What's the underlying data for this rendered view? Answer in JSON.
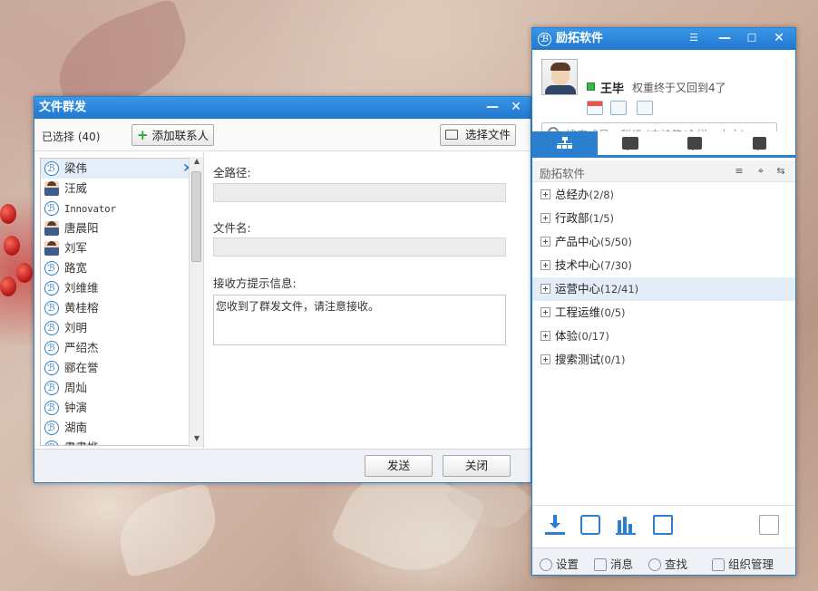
{
  "broadcast_window": {
    "title": "文件群发",
    "minimize": "—",
    "close": "✕",
    "selected_count": "已选择 (40)",
    "add_contact": "添加联系人",
    "select_file": "选择文件",
    "contacts": [
      {
        "name": "梁伟",
        "icon": "logo"
      },
      {
        "name": "汪威",
        "icon": "avatar"
      },
      {
        "name": "Innovator",
        "icon": "logo"
      },
      {
        "name": "唐晨阳",
        "icon": "avatar"
      },
      {
        "name": "刘军",
        "icon": "avatar"
      },
      {
        "name": "路宽",
        "icon": "logo"
      },
      {
        "name": "刘维维",
        "icon": "logo"
      },
      {
        "name": "黄桂榕",
        "icon": "logo"
      },
      {
        "name": "刘明",
        "icon": "logo"
      },
      {
        "name": "严绍杰",
        "icon": "logo"
      },
      {
        "name": "郦在誉",
        "icon": "logo"
      },
      {
        "name": "周灿",
        "icon": "logo"
      },
      {
        "name": "钟演",
        "icon": "logo"
      },
      {
        "name": "湖南",
        "icon": "logo"
      },
      {
        "name": "書書桦",
        "icon": "logo"
      }
    ],
    "full_path_label": "全路径:",
    "full_path_value": "",
    "file_name_label": "文件名:",
    "file_name_value": "",
    "receiver_hint_label": "接收方提示信息:",
    "receiver_hint_value": "您收到了群发文件，请注意接收。",
    "send_button": "发送",
    "close_button": "关闭"
  },
  "client_window": {
    "title": "励拓软件",
    "user": {
      "name": "王毕",
      "signature": "权重终于又回到4了",
      "status_color": "#39b54a"
    },
    "search_placeholder": "搜索成员、群组 (支持简/全拼、中文).",
    "tabs": [
      "organization",
      "chat",
      "message",
      "notice"
    ],
    "group_header": "励拓软件",
    "departments": [
      {
        "name": "总经办",
        "count": "(2/8)"
      },
      {
        "name": "行政部",
        "count": "(1/5)"
      },
      {
        "name": "产品中心",
        "count": "(5/50)"
      },
      {
        "name": "技术中心",
        "count": "(7/30)"
      },
      {
        "name": "运营中心",
        "count": "(12/41)"
      },
      {
        "name": "工程运维",
        "count": "(0/5)"
      },
      {
        "name": "体验",
        "count": "(0/17)"
      },
      {
        "name": "搜索测试",
        "count": "(0/1)"
      }
    ],
    "bottom_bar": {
      "settings": "设置",
      "messages": "消息",
      "find": "查找",
      "org_manage": "组织管理"
    }
  }
}
